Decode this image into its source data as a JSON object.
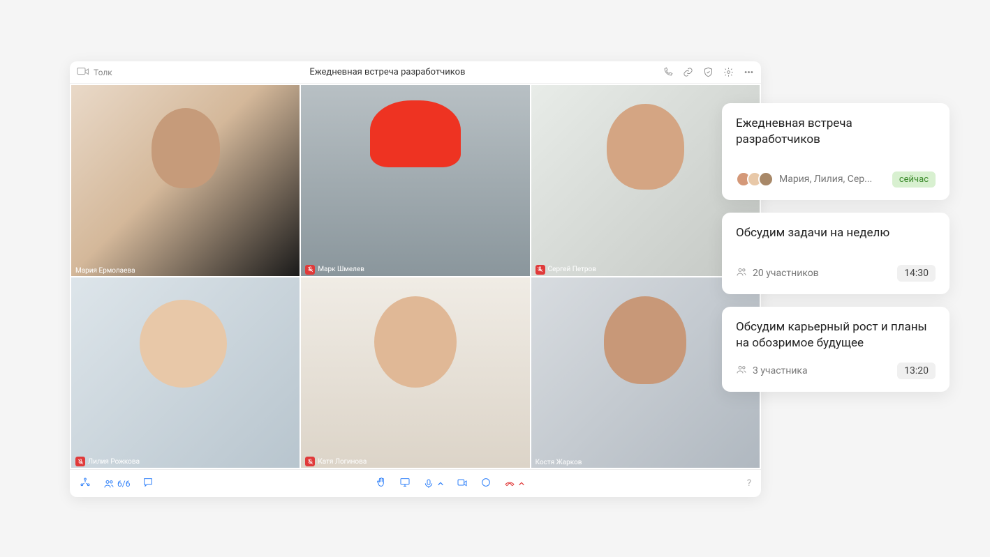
{
  "app_name": "Толк",
  "meeting_title": "Ежедневная встреча разработчиков",
  "participant_count": "6/6",
  "help_label": "?",
  "participants": [
    {
      "name": "Мария Ермолаева",
      "muted": false,
      "active": true
    },
    {
      "name": "Марк Шмелев",
      "muted": true,
      "active": false
    },
    {
      "name": "Сергей Петров",
      "muted": true,
      "active": false
    },
    {
      "name": "Лилия Рожкова",
      "muted": true,
      "active": false
    },
    {
      "name": "Катя Логинова",
      "muted": true,
      "active": false
    },
    {
      "name": "Костя Жарков",
      "muted": false,
      "active": false
    }
  ],
  "cards": [
    {
      "title": "Ежедневная встреча разработчиков",
      "subtitle": "Мария, Лилия, Сер...",
      "badge": "сейчас",
      "badge_type": "now"
    },
    {
      "title": "Обсудим задачи на неделю",
      "subtitle": "20 участников",
      "badge": "14:30",
      "badge_type": "time"
    },
    {
      "title": "Обсудим карьерный рост и планы на обозримое будущее",
      "subtitle": "3 участника",
      "badge": "13:20",
      "badge_type": "time"
    }
  ]
}
